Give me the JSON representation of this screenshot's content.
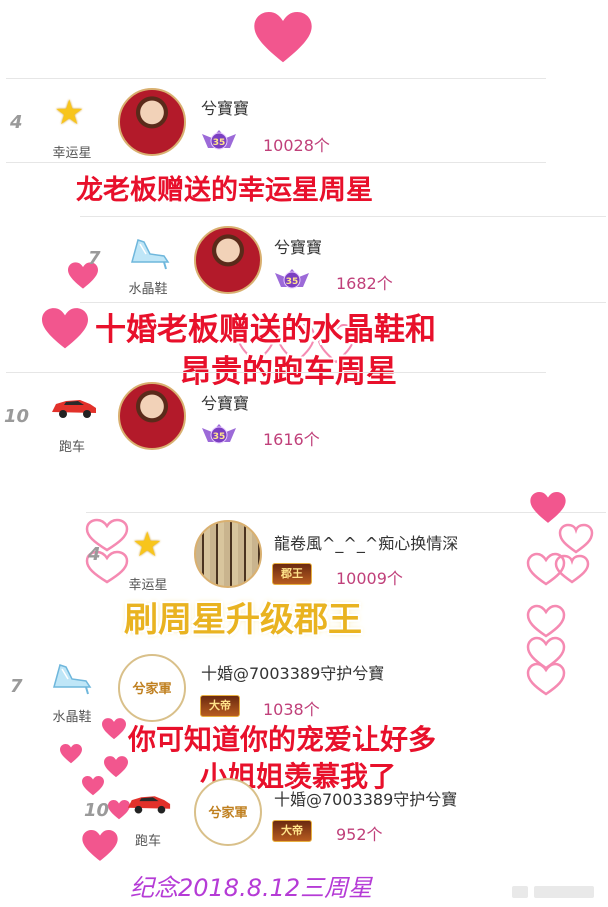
{
  "colors": {
    "heart": "#f2568e",
    "caption_red": "#e8102b",
    "caption_gold": "#e9b320",
    "count": "#c0407a"
  },
  "rows": [
    {
      "rank": "4",
      "gift": "幸运星",
      "gift_icon": "star-icon",
      "user": "兮寶寶",
      "level": "35",
      "count": "10028个"
    },
    {
      "rank": "7",
      "gift": "水晶鞋",
      "gift_icon": "crystal-shoe-icon",
      "user": "兮寶寶",
      "level": "35",
      "count": "1682个"
    },
    {
      "rank": "10",
      "gift": "跑车",
      "gift_icon": "sports-car-icon",
      "user": "兮寶寶",
      "level": "35",
      "count": "1616个"
    },
    {
      "rank": "4",
      "gift": "幸运星",
      "gift_icon": "star-icon",
      "user": "龍卷風^_^_^痴心换情深",
      "title_badge": "郡王",
      "count": "10009个"
    },
    {
      "rank": "7",
      "gift": "水晶鞋",
      "gift_icon": "crystal-shoe-icon",
      "user": "十婚@7003389守护兮寶",
      "title_badge": "大帝",
      "count": "1038个"
    },
    {
      "rank": "10",
      "gift": "跑车",
      "gift_icon": "sports-car-icon",
      "user": "十婚@7003389守护兮寶",
      "title_badge": "大帝",
      "count": "952个"
    }
  ],
  "avatar_text": "兮家軍",
  "captions": {
    "c1": "龙老板赠送的幸运星周星",
    "c2_line1": "十婚老板赠送的水晶鞋和",
    "c2_line2": "昂贵的跑车周星",
    "c3": "刷周星升级郡王",
    "c4_line1": "你可知道你的宠爱让好多",
    "c4_line2": "小姐姐羡慕我了",
    "c5": "纪念2018.8.12三周星"
  }
}
